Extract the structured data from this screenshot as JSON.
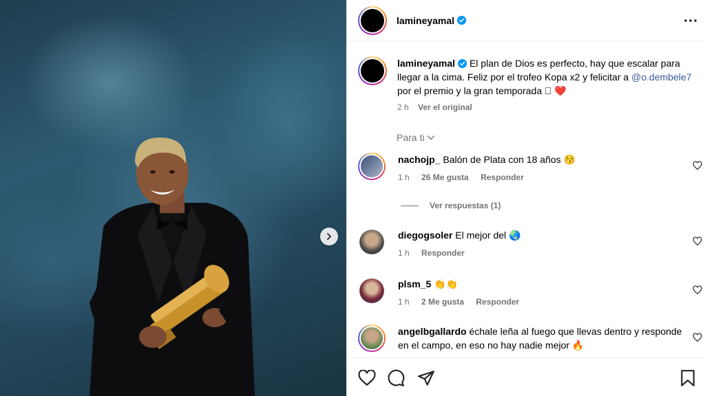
{
  "post": {
    "username": "lamineyamal",
    "caption_text": "El plan de Dios es perfecto, hay que escalar para llegar a la cima. Feliz por el trofeo Kopa x2 y felicitar a ",
    "caption_mention": "@o.dembele7",
    "caption_end": " por el premio y la gran temporada",
    "caption_emoji": "🏿 ❤️",
    "time": "2 h",
    "see_original": "Ver el original"
  },
  "filter": {
    "label": "Para ti"
  },
  "comments": [
    {
      "username": "nachojp_",
      "text": "Balón de Plata con 18 años 😚",
      "time": "1 h",
      "likes": "26 Me gusta",
      "reply": "Responder"
    },
    {
      "username": "diegogsoler",
      "text": "El mejor del 🌏",
      "time": "1 h",
      "reply": "Responder"
    },
    {
      "username": "plsm_5",
      "text": "👏👏",
      "time": "1 h",
      "likes": "2 Me gusta",
      "reply": "Responder"
    },
    {
      "username": "angelbgallardo",
      "text": "échale leña al fuego que llevas dentro y responde en el campo, en eso no hay nadie mejor 🔥"
    }
  ],
  "view_replies": "Ver respuestas (1)",
  "icons": {
    "verified": "verified-badge-icon",
    "more": "more-options-icon",
    "like": "heart-icon",
    "comment": "comment-icon",
    "share": "share-icon",
    "save": "bookmark-icon",
    "next": "chevron-right-icon"
  },
  "colors": {
    "verified": "#0095f6",
    "mention": "#3b5998",
    "secondary": "#737373"
  }
}
